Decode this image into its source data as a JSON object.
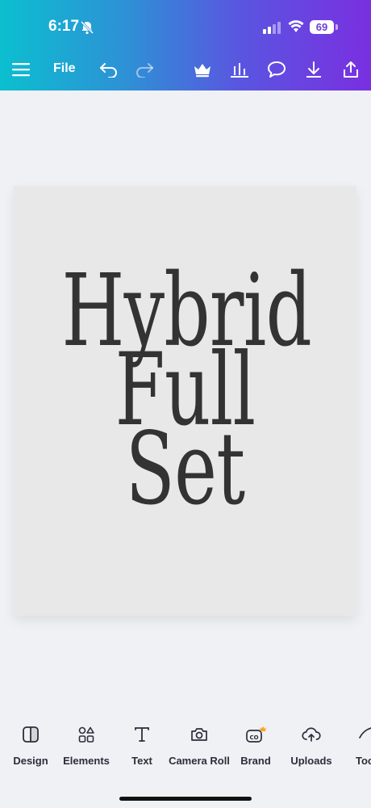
{
  "status_bar": {
    "time": "6:17",
    "battery": "69"
  },
  "toolbar": {
    "file_label": "File",
    "icons": [
      "menu-icon",
      "undo-icon",
      "redo-icon",
      "crown-icon",
      "chart-icon",
      "comment-icon",
      "download-icon",
      "share-icon"
    ]
  },
  "design": {
    "text": "Hybrid\nFull\nSet"
  },
  "bottom_nav": {
    "items": [
      {
        "label": "Design",
        "icon": "design-icon"
      },
      {
        "label": "Elements",
        "icon": "elements-icon"
      },
      {
        "label": "Text",
        "icon": "text-icon"
      },
      {
        "label": "Camera Roll",
        "icon": "camera-icon"
      },
      {
        "label": "Brand",
        "icon": "brand-icon"
      },
      {
        "label": "Uploads",
        "icon": "uploads-icon"
      },
      {
        "label": "Too",
        "icon": "tools-icon"
      }
    ]
  },
  "colors": {
    "accent_start": "#0bbfcf",
    "accent_end": "#7a2fe0",
    "crown": "#f5a623"
  }
}
